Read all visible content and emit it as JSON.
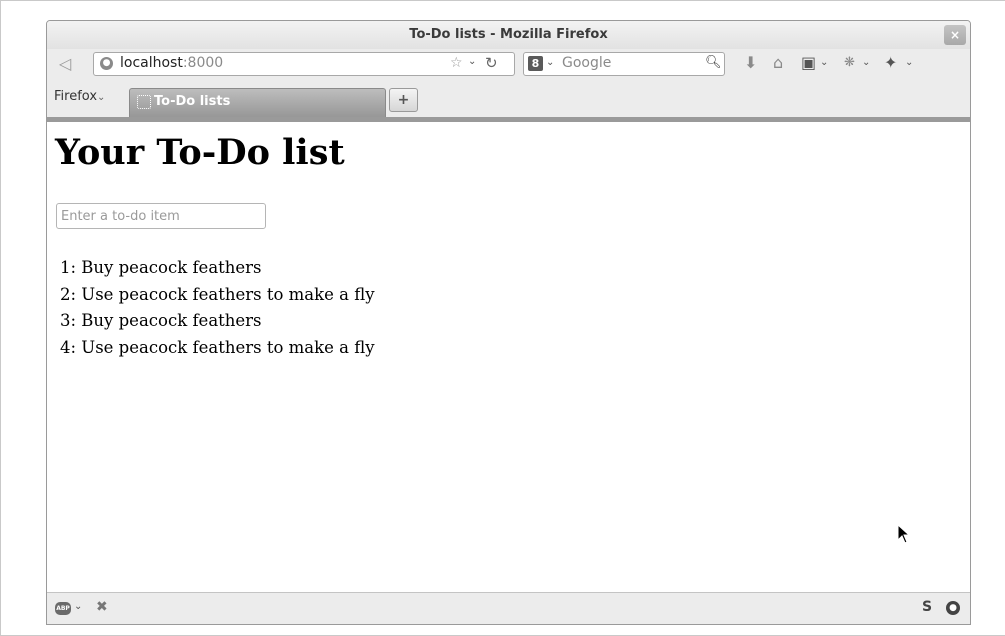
{
  "window": {
    "title": "To-Do lists - Mozilla Firefox",
    "close_glyph": "×"
  },
  "navbar": {
    "url_host": "localhost",
    "url_port": ":8000",
    "search_placeholder": "Google",
    "search_engine_glyph": "8"
  },
  "tabs": {
    "menu_label": "Firefox",
    "active_tab_label": "To-Do lists",
    "new_tab_glyph": "+"
  },
  "page": {
    "heading": "Your To-Do list",
    "input_placeholder": "Enter a to-do item",
    "items": [
      "1: Buy peacock feathers",
      "2: Use peacock feathers to make a fly",
      "3: Buy peacock feathers",
      "4: Use peacock feathers to make a fly"
    ]
  },
  "statusbar": {
    "abp_label": "ABP",
    "s_label": "S"
  }
}
